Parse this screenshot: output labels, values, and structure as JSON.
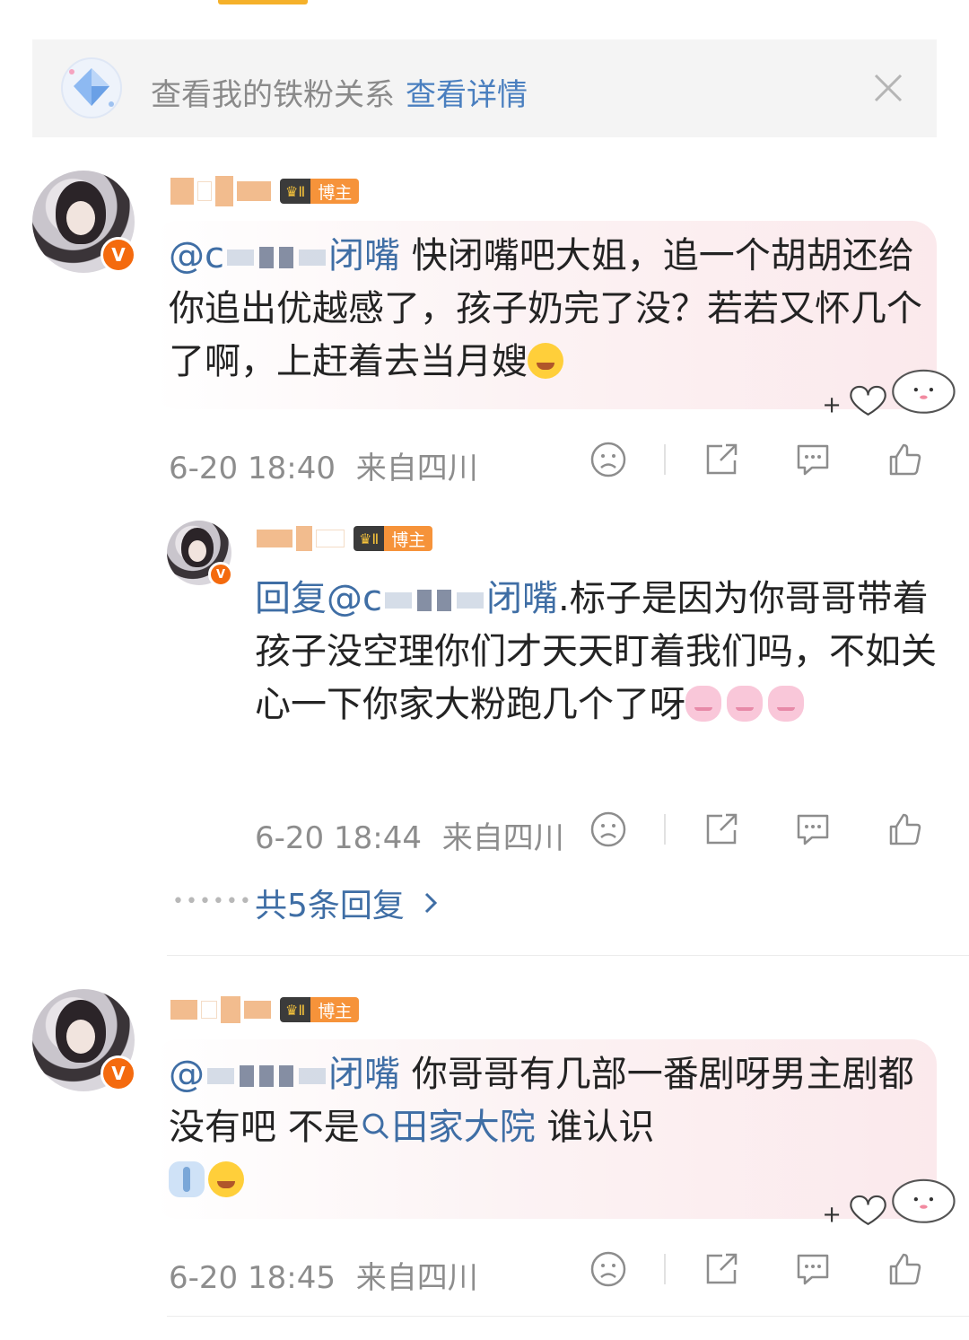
{
  "banner": {
    "text": "查看我的铁粉关系",
    "link": "查看详情"
  },
  "host_badge_label": "博主",
  "comments": [
    {
      "mention_prefix": "@c",
      "mention_suffix": "闭嘴",
      "body": "快闭嘴吧大姐，追一个胡胡还给你追出优越感了，孩子奶完了没？若若又怀几个了啊，上赶着去当月嫂",
      "time": "6-20 18:40",
      "location": "来自四川"
    },
    {
      "reply_prefix": "回复@c",
      "reply_suffix": "闭嘴",
      "body": ".标子是因为你哥哥带着孩子没空理你们才天天盯着我们吗，不如关心一下你家大粉跑几个了呀",
      "time": "6-20 18:44",
      "location": "来自四川",
      "more_replies": "共5条回复"
    },
    {
      "mention_prefix": "@",
      "mention_suffix": "闭嘴",
      "body_part1": "你哥哥有几部一番剧呀男主剧都没有吧 不是",
      "topic": "田家大院",
      "body_part2": "谁认识",
      "time": "6-20 18:45",
      "location": "来自四川"
    }
  ]
}
